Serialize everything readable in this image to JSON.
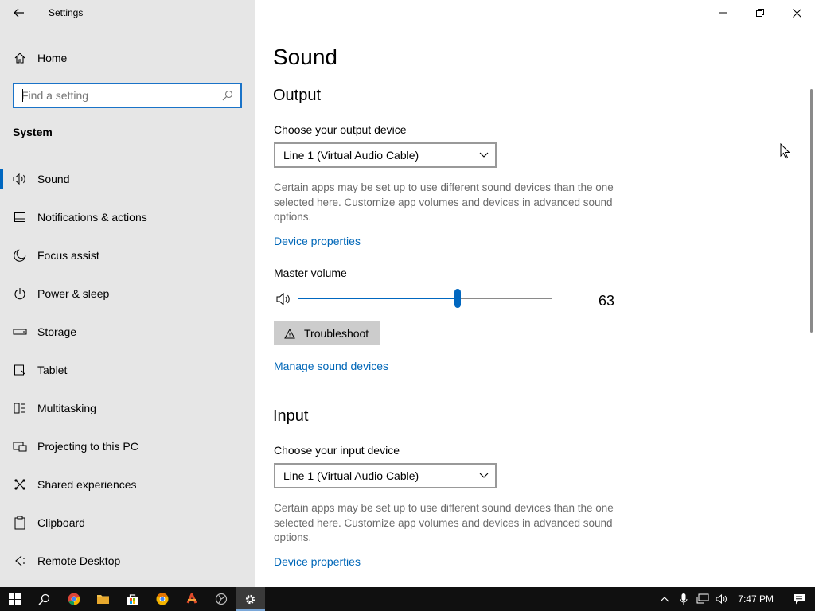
{
  "window": {
    "title": "Settings"
  },
  "sidebar": {
    "home_label": "Home",
    "search_placeholder": "Find a setting",
    "section": "System",
    "items": [
      {
        "label": "Sound",
        "icon": "speaker-icon"
      },
      {
        "label": "Notifications & actions",
        "icon": "notification-icon"
      },
      {
        "label": "Focus assist",
        "icon": "moon-icon"
      },
      {
        "label": "Power & sleep",
        "icon": "power-icon"
      },
      {
        "label": "Storage",
        "icon": "storage-icon"
      },
      {
        "label": "Tablet",
        "icon": "tablet-icon"
      },
      {
        "label": "Multitasking",
        "icon": "multitasking-icon"
      },
      {
        "label": "Projecting to this PC",
        "icon": "projecting-icon"
      },
      {
        "label": "Shared experiences",
        "icon": "shared-experiences-icon"
      },
      {
        "label": "Clipboard",
        "icon": "clipboard-icon"
      },
      {
        "label": "Remote Desktop",
        "icon": "remote-desktop-icon"
      }
    ],
    "active_index": 0
  },
  "main": {
    "title": "Sound",
    "output": {
      "heading": "Output",
      "device_label": "Choose your output device",
      "device_value": "Line 1 (Virtual Audio Cable)",
      "description": "Certain apps may be set up to use different sound devices than the one selected here. Customize app volumes and devices in advanced sound options.",
      "device_properties_link": "Device properties",
      "master_volume_label": "Master volume",
      "volume": 63,
      "volume_display": "63",
      "troubleshoot_label": "Troubleshoot",
      "manage_link": "Manage sound devices"
    },
    "input": {
      "heading": "Input",
      "device_label": "Choose your input device",
      "device_value": "Line 1 (Virtual Audio Cable)",
      "description": "Certain apps may be set up to use different sound devices than the one selected here. Customize app volumes and devices in advanced sound options.",
      "device_properties_link": "Device properties"
    }
  },
  "taskbar": {
    "clock": "7:47 PM",
    "accent": "#0067c0"
  }
}
